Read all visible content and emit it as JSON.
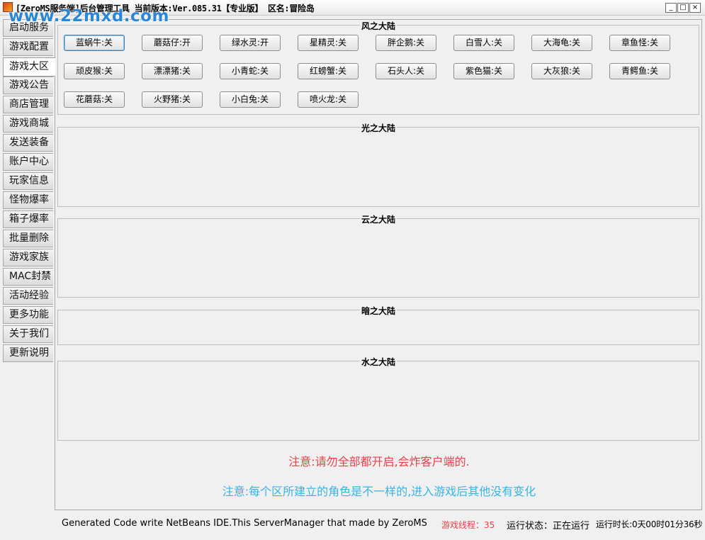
{
  "window": {
    "title": "[ZeroMS服务端]后台管理工具 当前版本:Ver.085.31【专业版】 区名:冒险岛",
    "watermark": "www.22mxd.com",
    "min_glyph": "_",
    "max_glyph": "□",
    "close_glyph": "×"
  },
  "sidebar": {
    "items": [
      {
        "label": "启动服务"
      },
      {
        "label": "游戏配置"
      },
      {
        "label": "游戏大区"
      },
      {
        "label": "游戏公告"
      },
      {
        "label": "商店管理"
      },
      {
        "label": "游戏商城"
      },
      {
        "label": "发送装备"
      },
      {
        "label": "账户中心"
      },
      {
        "label": "玩家信息"
      },
      {
        "label": "怪物爆率"
      },
      {
        "label": "箱子爆率"
      },
      {
        "label": "批量删除"
      },
      {
        "label": "游戏家族"
      },
      {
        "label": "MAC封禁"
      },
      {
        "label": "活动经验"
      },
      {
        "label": "更多功能"
      },
      {
        "label": "关于我们"
      },
      {
        "label": "更新说明"
      }
    ],
    "active": "游戏大区"
  },
  "groups": [
    {
      "title": "风之大陆",
      "buttons": [
        {
          "label": "蓝蜗牛:关"
        },
        {
          "label": "蘑菇仔:开"
        },
        {
          "label": "绿水灵:开"
        },
        {
          "label": "星精灵:关"
        },
        {
          "label": "胖企鹅:关"
        },
        {
          "label": "白雪人:关"
        },
        {
          "label": "大海龟:关"
        },
        {
          "label": "章鱼怪:关"
        },
        {
          "label": "顽皮猴:关"
        },
        {
          "label": "漂漂猪:关"
        },
        {
          "label": "小青蛇:关"
        },
        {
          "label": "红螃蟹:关"
        },
        {
          "label": "石头人:关"
        },
        {
          "label": "紫色猫:关"
        },
        {
          "label": "大灰狼:关"
        },
        {
          "label": "青鳄鱼:关"
        },
        {
          "label": "花蘑菇:关"
        },
        {
          "label": "火野猪:关"
        },
        {
          "label": "小白兔:关"
        },
        {
          "label": "喷火龙:关"
        }
      ]
    },
    {
      "title": "光之大陆",
      "buttons": []
    },
    {
      "title": "云之大陆",
      "buttons": []
    },
    {
      "title": "暗之大陆",
      "buttons": []
    },
    {
      "title": "水之大陆",
      "buttons": []
    }
  ],
  "notes": {
    "warning": "注意:请勿全部都开启,会炸客户端的.",
    "info": "注意:每个区所建立的角色是不一样的,进入游戏后其他没有变化"
  },
  "status": {
    "credit": "Generated Code write NetBeans IDE.This ServerManager that made by ZeroMS",
    "threads": "游戏线程：35",
    "state": "运行状态：正在运行",
    "uptime": "运行时长:0天00时01分36秒"
  },
  "colors": {
    "warning": "#e8414a",
    "info": "#37b5e6",
    "watermark": "#2a86d6"
  }
}
